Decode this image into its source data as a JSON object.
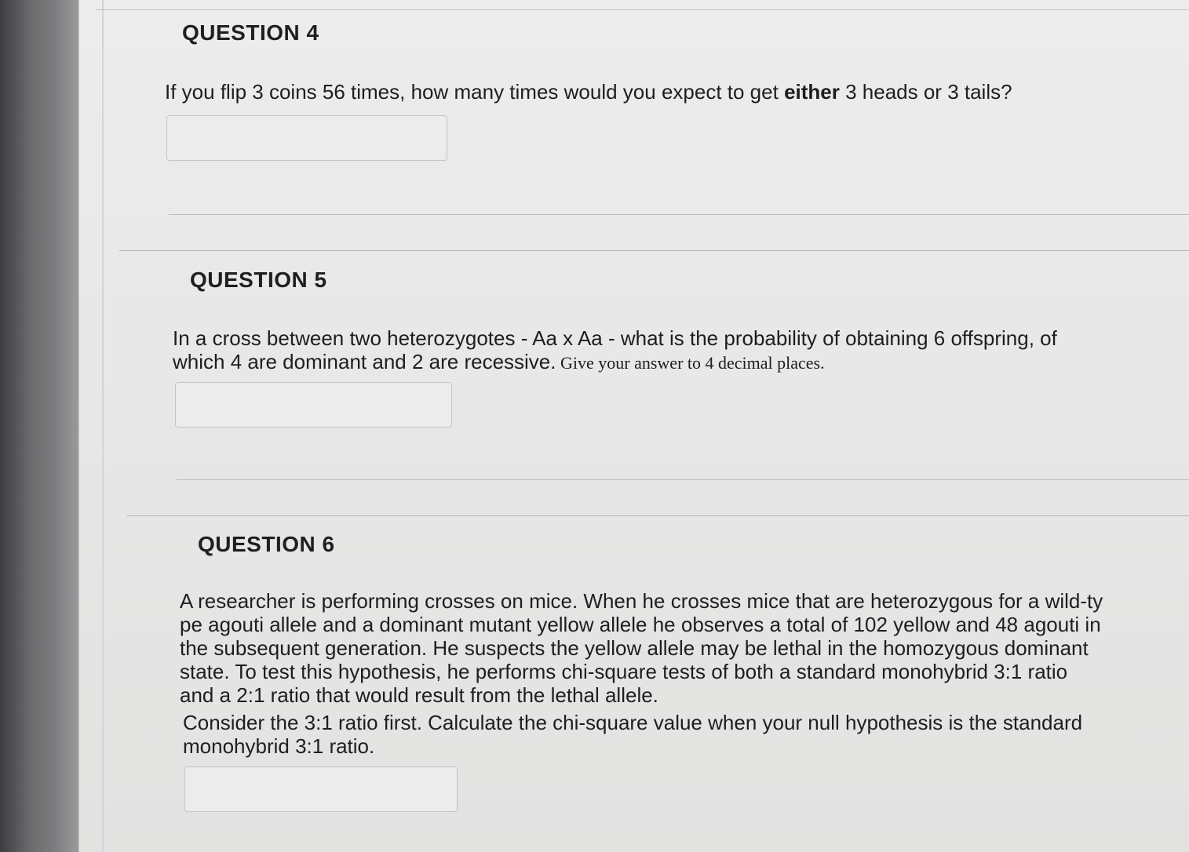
{
  "questions": [
    {
      "title": "QUESTION 4",
      "text_before_bold": "If you flip 3 coins 56 times, how many times would you expect to get ",
      "text_bold": "either",
      "text_after_bold": " 3 heads or 3 tails?",
      "answer_value": ""
    },
    {
      "title": "QUESTION 5",
      "text_line1": "In a cross between two heterozygotes - Aa x Aa - what is the probability of obtaining 6 offspring, of",
      "text_line2": "which 4 are dominant and 2 are recessive.",
      "text_serif": " Give your answer to 4 decimal places.",
      "answer_value": ""
    },
    {
      "title": "QUESTION 6",
      "para1_lines": [
        "A researcher is performing crosses on mice. When he crosses mice that are heterozygous for a wild-ty",
        "pe agouti allele and a dominant mutant yellow allele he observes a total of 102 yellow and 48 agouti in",
        "the subsequent generation. He suspects the yellow allele may be lethal in the homozygous dominant",
        "state. To test this hypothesis, he performs chi-square tests of both a standard monohybrid 3:1 ratio",
        "and a 2:1 ratio that would result from the lethal allele."
      ],
      "para2_lines": [
        "Consider the 3:1 ratio first. Calculate the chi-square value when your null hypothesis is the standard",
        "monohybrid 3:1 ratio."
      ],
      "answer_value": ""
    }
  ]
}
